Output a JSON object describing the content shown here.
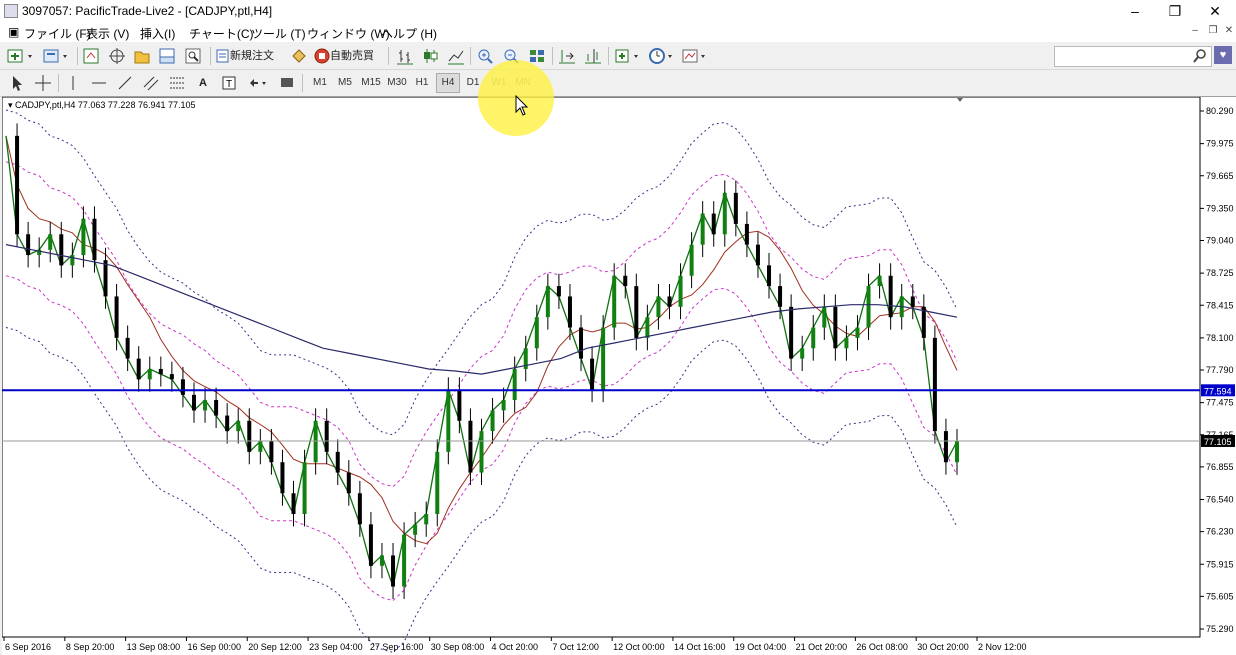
{
  "window": {
    "title": "3097057: PacificTrade-Live2 - [CADJPY,ptl,H4]"
  },
  "menu": [
    "ファイル (F)",
    "表示 (V)",
    "挿入(I)",
    "チャート(C)",
    "ツール (T)",
    "ウィンドウ (W)",
    "ヘルプ (H)"
  ],
  "toolbar": {
    "new_order_label": "新規注文",
    "auto_trade_label": "自動売買"
  },
  "timeframes": [
    "M1",
    "M5",
    "M15",
    "M30",
    "H1",
    "H4",
    "D1",
    "W1",
    "MN"
  ],
  "active_timeframe": "H4",
  "search": {
    "value": ""
  },
  "chart": {
    "header": "CADJPY,ptl,H4  77.063 77.228 76.941 77.105",
    "hline_price_label": "77.594",
    "current_price_label": "77.105",
    "price_ticks": [
      "80.290",
      "79.975",
      "79.665",
      "79.350",
      "79.040",
      "78.725",
      "78.415",
      "78.100",
      "77.790",
      "77.475",
      "77.165",
      "76.855",
      "76.540",
      "76.230",
      "75.915",
      "75.605",
      "75.290"
    ],
    "time_ticks": [
      "6 Sep 2016",
      "8 Sep 20:00",
      "13 Sep 08:00",
      "16 Sep 00:00",
      "20 Sep 12:00",
      "23 Sep 04:00",
      "27 Sep 16:00",
      "30 Sep 08:00",
      "4 Oct 20:00",
      "7 Oct 12:00",
      "12 Oct 00:00",
      "14 Oct 16:00",
      "19 Oct 04:00",
      "21 Oct 20:00",
      "26 Oct 08:00",
      "30 Oct 20:00",
      "2 Nov 12:00"
    ]
  },
  "chart_data": {
    "type": "line",
    "symbol": "CADJPY",
    "timeframe": "H4",
    "last_bar": {
      "open": 77.063,
      "high": 77.228,
      "low": 76.941,
      "close": 77.105
    },
    "ylim": [
      75.29,
      80.29
    ],
    "horizontal_line": 77.594,
    "series": [
      {
        "values": [
          80.05,
          79.1,
          78.9,
          78.95,
          79.1,
          78.8,
          78.9,
          79.25,
          78.85,
          78.5,
          78.1,
          77.9,
          77.7,
          77.8,
          77.75,
          77.7,
          77.55,
          77.4,
          77.5,
          77.35,
          77.2,
          77.3,
          77.0,
          77.1,
          76.9,
          76.6,
          76.4,
          76.9,
          77.3,
          77.0,
          76.8,
          76.6,
          76.3,
          75.9,
          76.0,
          75.7,
          76.2,
          76.3,
          76.4,
          77.0,
          77.6,
          77.3,
          76.8,
          77.2,
          77.4,
          77.5,
          77.8,
          78.0,
          78.3,
          78.6,
          78.5,
          78.2,
          77.9,
          77.6,
          78.2,
          78.7,
          78.6,
          78.1,
          78.3,
          78.5,
          78.4,
          78.7,
          79.0,
          79.3,
          79.1,
          79.5,
          79.2,
          79.0,
          78.8,
          78.6,
          78.4,
          77.9,
          78.0,
          78.2,
          78.4,
          78.0,
          78.1,
          78.2,
          78.6,
          78.7,
          78.3,
          78.5,
          78.4,
          78.1,
          77.2,
          76.9,
          77.1
        ]
      },
      {
        "name": "",
        "values": [
          79.0,
          78.95,
          78.9,
          78.85,
          78.8,
          78.7,
          78.6,
          78.5,
          78.4,
          78.3,
          78.2,
          78.1,
          78.0,
          77.95,
          77.9,
          77.85,
          77.8,
          77.78,
          77.75,
          77.8,
          77.85,
          77.9,
          78.0,
          78.05,
          78.1,
          78.15,
          78.2,
          78.25,
          78.3,
          78.35,
          78.38,
          78.4,
          78.42,
          78.42,
          78.4,
          78.35,
          78.3
        ]
      }
    ]
  }
}
